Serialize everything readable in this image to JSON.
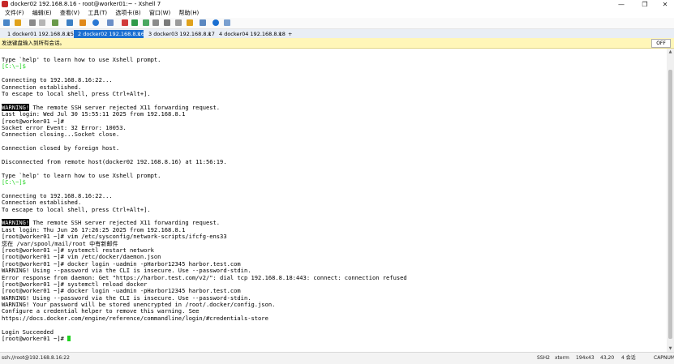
{
  "window": {
    "title": "docker02 192.168.8.16 - root@worker01:~ - Xshell 7"
  },
  "menu": [
    "文件(F)",
    "编辑(E)",
    "查看(V)",
    "工具(T)",
    "选项卡(B)",
    "窗口(W)",
    "帮助(H)"
  ],
  "tabs": [
    {
      "label": "1 docker01 192.168.8.15",
      "active": false
    },
    {
      "label": "2 docker02 192.168.8.16",
      "active": true
    },
    {
      "label": "3 docker03 192.168.8.17",
      "active": false
    },
    {
      "label": "4 docker04 192.168.8.18",
      "active": false
    }
  ],
  "tab_close": "×",
  "tab_add": "+",
  "notice": {
    "text": "发送键盘输入到所有会话。",
    "toggle": "OFF"
  },
  "terminal": {
    "lines": [
      [
        {
          "t": "Type `help' to learn how to use Xshell prompt."
        }
      ],
      [
        {
          "t": "[C:\\~]$",
          "c": "green"
        }
      ],
      [
        {
          "t": ""
        }
      ],
      [
        {
          "t": "Connecting to 192.168.8.16:22..."
        }
      ],
      [
        {
          "t": "Connection established."
        }
      ],
      [
        {
          "t": "To escape to local shell, press Ctrl+Alt+]."
        }
      ],
      [
        {
          "t": ""
        }
      ],
      [
        {
          "t": "WARNING!",
          "c": "inv"
        },
        {
          "t": " The remote SSH server rejected X11 forwarding request."
        }
      ],
      [
        {
          "t": "Last login: Wed Jul 30 15:55:11 2025 from 192.168.8.1"
        }
      ],
      [
        {
          "t": "[root@worker01 ~]#"
        }
      ],
      [
        {
          "t": "Socket error Event: 32 Error: 10053."
        }
      ],
      [
        {
          "t": "Connection closing...Socket close."
        }
      ],
      [
        {
          "t": ""
        }
      ],
      [
        {
          "t": "Connection closed by foreign host."
        }
      ],
      [
        {
          "t": ""
        }
      ],
      [
        {
          "t": "Disconnected from remote host(docker02 192.168.8.16) at 11:56:19."
        }
      ],
      [
        {
          "t": ""
        }
      ],
      [
        {
          "t": "Type `help' to learn how to use Xshell prompt."
        }
      ],
      [
        {
          "t": "[C:\\~]$",
          "c": "green"
        }
      ],
      [
        {
          "t": ""
        }
      ],
      [
        {
          "t": "Connecting to 192.168.8.16:22..."
        }
      ],
      [
        {
          "t": "Connection established."
        }
      ],
      [
        {
          "t": "To escape to local shell, press Ctrl+Alt+]."
        }
      ],
      [
        {
          "t": ""
        }
      ],
      [
        {
          "t": "WARNING!",
          "c": "inv"
        },
        {
          "t": " The remote SSH server rejected X11 forwarding request."
        }
      ],
      [
        {
          "t": "Last login: Thu Jun 26 17:26:25 2025 from 192.168.8.1"
        }
      ],
      [
        {
          "t": "[root@worker01 ~]# vim /etc/sysconfig/network-scripts/ifcfg-ens33"
        }
      ],
      [
        {
          "t": "您在 /var/spool/mail/root 中有新邮件"
        }
      ],
      [
        {
          "t": "[root@worker01 ~]# systemctl restart network"
        }
      ],
      [
        {
          "t": "[root@worker01 ~]# vim /etc/docker/daemon.json"
        }
      ],
      [
        {
          "t": "[root@worker01 ~]# docker login -uadmin -pHarbor12345 harbor.test.com"
        }
      ],
      [
        {
          "t": "WARNING! Using --password via the CLI is insecure. Use --password-stdin."
        }
      ],
      [
        {
          "t": "Error response from daemon: Get \"https://harbor.test.com/v2/\": dial tcp 192.168.8.18:443: connect: connection refused"
        }
      ],
      [
        {
          "t": "[root@worker01 ~]# systemctl reload docker"
        }
      ],
      [
        {
          "t": "[root@worker01 ~]# docker login -uadmin -pHarbor12345 harbor.test.com"
        }
      ],
      [
        {
          "t": "WARNING! Using --password via the CLI is insecure. Use --password-stdin."
        }
      ],
      [
        {
          "t": "WARNING! Your password will be stored unencrypted in /root/.docker/config.json."
        }
      ],
      [
        {
          "t": "Configure a credential helper to remove this warning. See"
        }
      ],
      [
        {
          "t": "https://docs.docker.com/engine/reference/commandline/login/#credentials-store"
        }
      ],
      [
        {
          "t": ""
        }
      ],
      [
        {
          "t": "Login Succeeded"
        }
      ],
      [
        {
          "t": "[root@worker01 ~]# "
        },
        {
          "t": "",
          "c": "cursor"
        }
      ]
    ]
  },
  "status": {
    "connection": "ssh://root@192.168.8.16:22",
    "protocol": "SSH2",
    "terminal": "xterm",
    "size": "194x43",
    "cursor_pos": "43,20",
    "sessions": "4 会话",
    "caps": "CAP",
    "num": "NUM"
  },
  "colors": {
    "accent": "#1a6fd1",
    "terminal_green": "#1fd41f",
    "notice_bg": "#fff6b8"
  }
}
